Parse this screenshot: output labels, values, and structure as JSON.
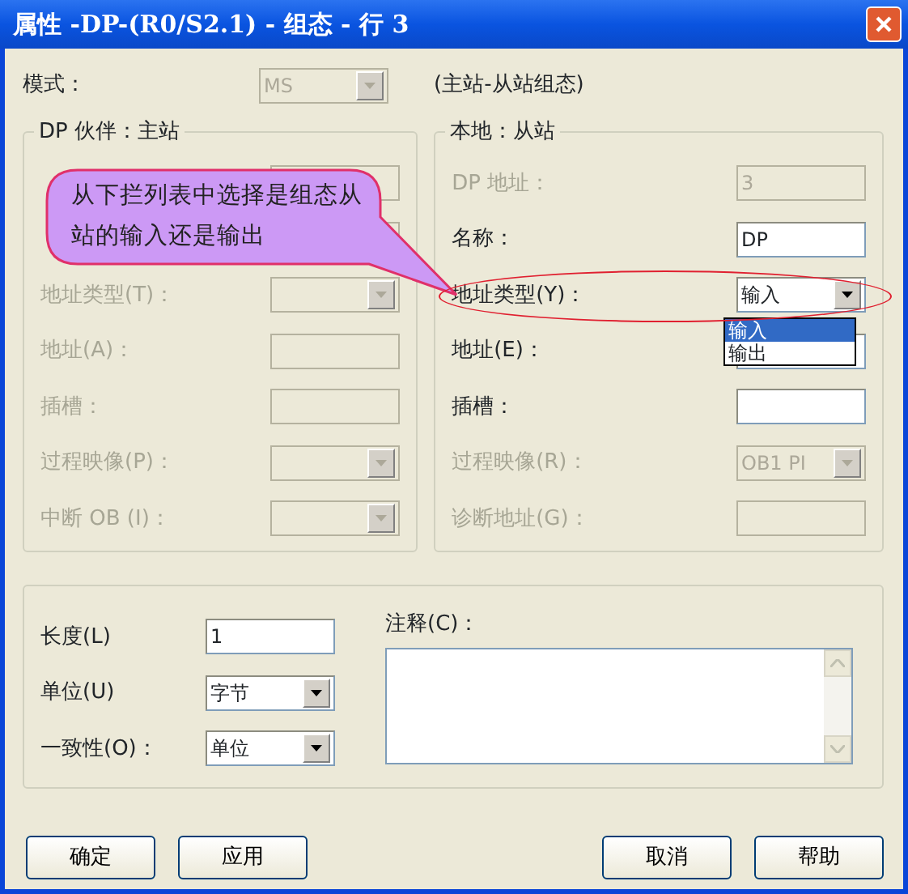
{
  "window": {
    "title": "属性 -DP-(R0/S2.1) - 组态 - 行 3"
  },
  "mode": {
    "label": "模式：",
    "value": "MS",
    "disabled": true,
    "note": "(主站-从站组态)"
  },
  "partner": {
    "title": "DP 伙伴：主站",
    "rows": [
      {
        "kind": "text",
        "disabled": true
      },
      {
        "kind": "text",
        "disabled": true
      },
      {
        "label": "地址类型(T)：",
        "kind": "combo",
        "disabled": true
      },
      {
        "label": "地址(A)：",
        "kind": "text",
        "disabled": true
      },
      {
        "label": "插槽：",
        "kind": "text",
        "disabled": true
      },
      {
        "label": "过程映像(P)：",
        "kind": "combo",
        "disabled": true
      },
      {
        "label": "中断 OB (I)：",
        "kind": "combo",
        "disabled": true
      }
    ]
  },
  "local": {
    "title": "本地：从站",
    "rows": [
      {
        "label": "DP 地址：",
        "kind": "text",
        "value": "3",
        "disabled": true
      },
      {
        "label": "名称：",
        "kind": "text",
        "value": "DP",
        "disabled": false
      },
      {
        "label": "地址类型(Y)：",
        "kind": "combo",
        "value": "输入",
        "disabled": false,
        "open": true,
        "options": [
          {
            "label": "输入",
            "selected": true
          },
          {
            "label": "输出",
            "selected": false
          }
        ]
      },
      {
        "label": "地址(E)：",
        "kind": "text",
        "disabled": false
      },
      {
        "label": "插槽：",
        "kind": "text",
        "disabled": false
      },
      {
        "label": "过程映像(R)：",
        "kind": "combo",
        "value": "OB1 PI",
        "disabled": true
      },
      {
        "label": "诊断地址(G)：",
        "kind": "text",
        "disabled": true
      }
    ]
  },
  "callout": {
    "text": "从下拦列表中选择是组态从站的输入还是输出"
  },
  "bottom": {
    "rows": [
      {
        "label": "长度(L)",
        "kind": "text",
        "value": "1"
      },
      {
        "label": "单位(U)",
        "kind": "combo",
        "value": "字节"
      },
      {
        "label": "一致性(O)：",
        "kind": "combo",
        "value": "单位"
      }
    ],
    "comment": {
      "label": "注释(C)："
    }
  },
  "left_buttons": [
    {
      "label": "确定"
    },
    {
      "label": "应用"
    }
  ],
  "right_buttons": [
    {
      "label": "取消"
    },
    {
      "label": "帮助"
    }
  ]
}
